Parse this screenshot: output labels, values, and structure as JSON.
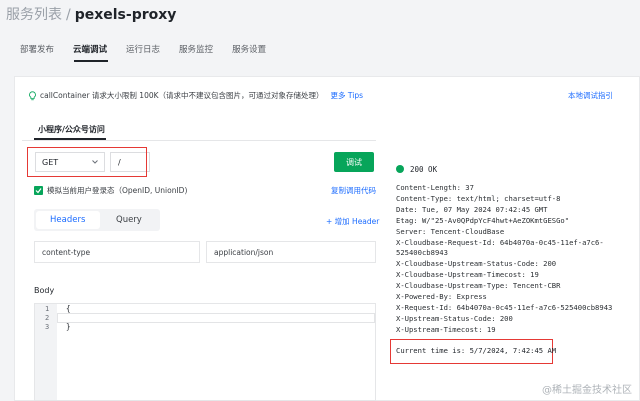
{
  "breadcrumb": {
    "parent": "服务列表",
    "separator": "/",
    "current": "pexels-proxy"
  },
  "tabs": [
    {
      "label": "部署发布"
    },
    {
      "label": "云端调试"
    },
    {
      "label": "运行日志"
    },
    {
      "label": "服务监控"
    },
    {
      "label": "服务设置"
    }
  ],
  "notice": {
    "text": "callContainer 请求大小限制 100K（请求中不建议包含图片，可通过对象存储处理）",
    "more_link": "更多 Tips",
    "guide_link": "本地调试指引"
  },
  "subtab": {
    "label": "小程序/公众号访问"
  },
  "request": {
    "method": "GET",
    "path": "/",
    "send_label": "调试",
    "simulate_label": "模拟当前用户登录态（OpenID, UnionID)",
    "copy_label": "复制调用代码",
    "tab_headers": "Headers",
    "tab_query": "Query",
    "add_header": "+ 增加 Header",
    "header_key": "content-type",
    "header_value": "application/json",
    "body_label": "Body",
    "code_lines": [
      {
        "num": "1",
        "text": "{"
      },
      {
        "num": "2",
        "text": ""
      },
      {
        "num": "3",
        "text": "}"
      }
    ]
  },
  "response": {
    "status": "200 OK",
    "status_color": "#07a55a",
    "headers_text": "Content-Length: 37\nContent-Type: text/html; charset=utf-8\nDate: Tue, 07 May 2024 07:42:45 GMT\nEtag: W/\"25-Av0QPdpYcF4hwt+AeZOKmtGESGo\"\nServer: Tencent-CloudBase\nX-Cloudbase-Request-Id: 64b4070a-0c45-11ef-a7c6-\n525400cb8943\nX-Cloudbase-Upstream-Status-Code: 200\nX-Cloudbase-Upstream-Timecost: 19\nX-Cloudbase-Upstream-Type: Tencent-CBR\nX-Powered-By: Express\nX-Request-Id: 64b4070a-0c45-11ef-a7c6-525400cb8943\nX-Upstream-Status-Code: 200\nX-Upstream-Timecost: 19",
    "body_text": "Current time is: 5/7/2024, 7:42:45 AM"
  },
  "watermark": "@稀土掘金技术社区",
  "colors": {
    "accent": "#1c6cff",
    "primary_button": "#07a55a",
    "highlight_box": "#e53935"
  }
}
